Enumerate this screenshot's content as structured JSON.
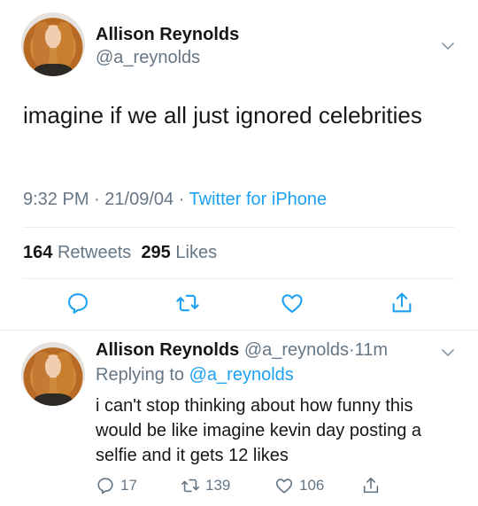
{
  "tweet": {
    "display_name": "Allison Reynolds",
    "handle": "@a_reynolds",
    "text": "imagine if we all just ignored celebrities",
    "time": "9:32 PM",
    "date": "21/09/04",
    "source": "Twitter for iPhone",
    "retweets_count": "164",
    "retweets_label": "Retweets",
    "likes_count": "295",
    "likes_label": "Likes"
  },
  "reply": {
    "display_name": "Allison Reynolds",
    "handle": "@a_reynolds",
    "age": "11m",
    "replying_label": "Replying to",
    "replying_to": "@a_reynolds",
    "text": "i can't stop thinking about how funny this would be like imagine kevin day posting a selfie and it gets 12 likes",
    "reply_count": "17",
    "retweet_count": "139",
    "like_count": "106"
  },
  "icons": {
    "menu": "chevron-down-icon",
    "reply": "reply-icon",
    "retweet": "retweet-icon",
    "like": "heart-icon",
    "share": "share-icon"
  },
  "colors": {
    "text": "#14171a",
    "secondary": "#657786",
    "link": "#1da1f2",
    "divider": "#e6ecf0"
  }
}
